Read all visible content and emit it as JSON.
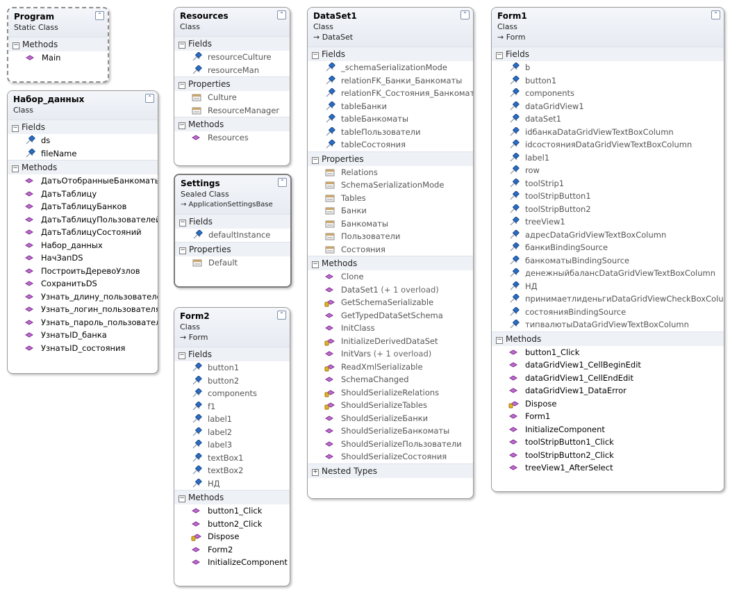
{
  "icons": {
    "field": "field-icon",
    "method": "method-icon",
    "property": "property-icon",
    "protected": "protected-method-icon"
  },
  "program": {
    "title": "Program",
    "stereotype": "Static Class",
    "sections": {
      "methods": "Methods"
    },
    "methods": [
      "Main"
    ]
  },
  "nabor": {
    "title": "Набор_данных",
    "stereotype": "Class",
    "sections": {
      "fields": "Fields",
      "methods": "Methods"
    },
    "fields": [
      "ds",
      "fileName"
    ],
    "methods": [
      "ДатьОтобранныеБанкоматы",
      "ДатьТаблицу",
      "ДатьТаблицуБанков",
      "ДатьТаблицуПользователей",
      "ДатьТаблицуСостояний",
      "Набор_данных",
      "НачЗапDS",
      "ПостроитьДеревоУзлов",
      "СохранитьDS",
      "Узнать_длину_пользователей",
      "Узнать_логин_пользователя",
      "Узнать_пароль_пользователя",
      "УзнатьID_банка",
      "УзнатьID_состояния"
    ]
  },
  "resources": {
    "title": "Resources",
    "stereotype": "Class",
    "sections": {
      "fields": "Fields",
      "properties": "Properties",
      "methods": "Methods"
    },
    "fields": [
      "resourceCulture",
      "resourceMan"
    ],
    "properties": [
      "Culture",
      "ResourceManager"
    ],
    "methods": [
      "Resources"
    ]
  },
  "settings": {
    "title": "Settings",
    "stereotype": "Sealed Class",
    "base": "→ ApplicationSettingsBase",
    "sections": {
      "fields": "Fields",
      "properties": "Properties"
    },
    "fields": [
      "defaultInstance"
    ],
    "properties": [
      "Default"
    ]
  },
  "form2": {
    "title": "Form2",
    "stereotype": "Class",
    "base": "→ Form",
    "sections": {
      "fields": "Fields",
      "methods": "Methods"
    },
    "fields": [
      "button1",
      "button2",
      "components",
      "f1",
      "label1",
      "label2",
      "label3",
      "textBox1",
      "textBox2",
      "НД"
    ],
    "methods": [
      "button1_Click",
      "button2_Click",
      "Dispose",
      "Form2",
      "InitializeComponent"
    ]
  },
  "dataset1": {
    "title": "DataSet1",
    "stereotype": "Class",
    "base": "→ DataSet",
    "sections": {
      "fields": "Fields",
      "properties": "Properties",
      "methods": "Methods",
      "nested": "Nested Types"
    },
    "fields": [
      "_schemaSerializationMode",
      "relationFK_Банки_Банкоматы",
      "relationFK_Состояния_Банкоматы",
      "tableБанки",
      "tableБанкоматы",
      "tableПользователи",
      "tableСостояния"
    ],
    "properties": [
      "Relations",
      "SchemaSerializationMode",
      "Tables",
      "Банки",
      "Банкоматы",
      "Пользователи",
      "Состояния"
    ],
    "methods": [
      "Clone",
      "DataSet1",
      "GetSchemaSerializable",
      "GetTypedDataSetSchema",
      "InitClass",
      "InitializeDerivedDataSet",
      "InitVars",
      "ReadXmlSerializable",
      "SchemaChanged",
      "ShouldSerializeRelations",
      "ShouldSerializeTables",
      "ShouldSerializeБанки",
      "ShouldSerializeБанкоматы",
      "ShouldSerializeПользователи",
      "ShouldSerializeСостояния"
    ],
    "overload1": "(+ 1 overload)",
    "overload2": "(+ 1 overload)"
  },
  "form1": {
    "title": "Form1",
    "stereotype": "Class",
    "base": "→ Form",
    "sections": {
      "fields": "Fields",
      "methods": "Methods"
    },
    "fields": [
      "b",
      "button1",
      "components",
      "dataGridView1",
      "dataSet1",
      "idбанкаDataGridViewTextBoxColumn",
      "idсостоянияDataGridViewTextBoxColumn",
      "label1",
      "row",
      "toolStrip1",
      "toolStripButton1",
      "toolStripButton2",
      "treeView1",
      "адресDataGridViewTextBoxColumn",
      "банкиBindingSource",
      "банкоматыBindingSource",
      "денежныйбалансDataGridViewTextBoxColumn",
      "НД",
      "принимаетлиденьгиDataGridViewCheckBoxColumn",
      "состоянияBindingSource",
      "типвалютыDataGridViewTextBoxColumn"
    ],
    "methods": [
      "button1_Click",
      "dataGridView1_CellBeginEdit",
      "dataGridView1_CellEndEdit",
      "dataGridView1_DataError",
      "Dispose",
      "Form1",
      "InitializeComponent",
      "toolStripButton1_Click",
      "toolStripButton2_Click",
      "treeView1_AfterSelect"
    ]
  }
}
